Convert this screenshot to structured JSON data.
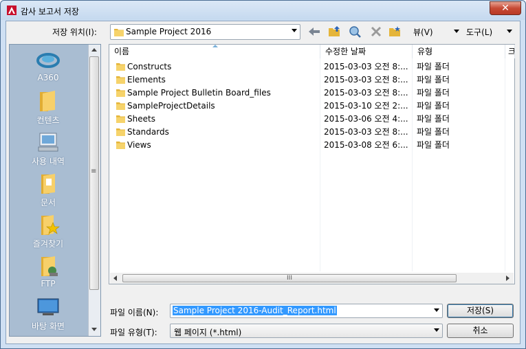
{
  "window": {
    "title": "감사 보고서 저장",
    "close_label": "✕"
  },
  "toolbar": {
    "location_label": "저장 위치(I):",
    "location_value": "Sample Project 2016",
    "views_label": "뷰(V)",
    "tools_label": "도구(L)"
  },
  "places": [
    {
      "label": "A360",
      "icon": "a360-icon"
    },
    {
      "label": "컨텐츠",
      "icon": "folder-icon"
    },
    {
      "label": "사용 내역",
      "icon": "history-icon"
    },
    {
      "label": "문서",
      "icon": "documents-icon"
    },
    {
      "label": "즐겨찾기",
      "icon": "favorites-icon"
    },
    {
      "label": "FTP",
      "icon": "ftp-icon"
    },
    {
      "label": "바탕 화면",
      "icon": "desktop-icon"
    }
  ],
  "filelist": {
    "columns": [
      "이름",
      "수정한 날짜",
      "유형",
      "크"
    ],
    "rows": [
      {
        "name": "Constructs",
        "date": "2015-03-03 오전 8:...",
        "type": "파일 폴더"
      },
      {
        "name": "Elements",
        "date": "2015-03-03 오전 8:...",
        "type": "파일 폴더"
      },
      {
        "name": "Sample Project Bulletin Board_files",
        "date": "2015-03-03 오전 8:...",
        "type": "파일 폴더"
      },
      {
        "name": "SampleProjectDetails",
        "date": "2015-03-10 오전 2:...",
        "type": "파일 폴더"
      },
      {
        "name": "Sheets",
        "date": "2015-03-06 오전 4:...",
        "type": "파일 폴더"
      },
      {
        "name": "Standards",
        "date": "2015-03-03 오전 8:...",
        "type": "파일 폴더"
      },
      {
        "name": "Views",
        "date": "2015-03-08 오전 6:...",
        "type": "파일 폴더"
      }
    ],
    "hscroll_grip": "III",
    "vgrip": "≡"
  },
  "footer": {
    "filename_label": "파일 이름(N):",
    "filename_value": "Sample Project 2016-Audit_Report.html",
    "filetype_label": "파일 유형(T):",
    "filetype_value": "웹 페이지 (*.html)",
    "save_label": "저장(S)",
    "cancel_label": "취소"
  },
  "colors": {
    "accent": "#3399ff",
    "places_bg": "#a9bdd2",
    "title_bg": "#c5d9ef",
    "close_bg": "#c74a35"
  }
}
